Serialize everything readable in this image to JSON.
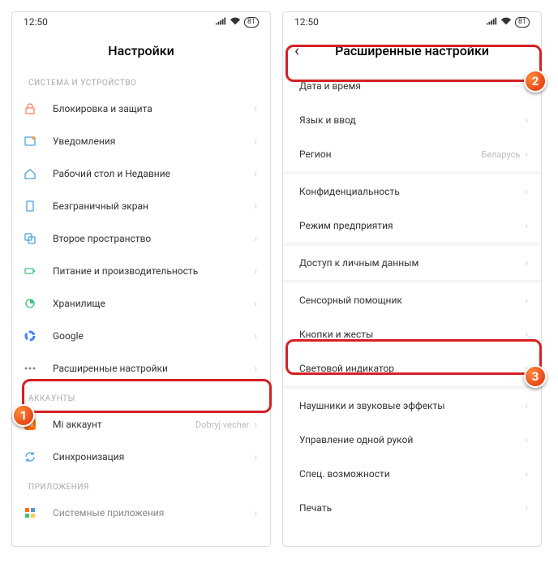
{
  "status": {
    "time": "12:50",
    "battery": "81"
  },
  "left": {
    "title": "Настройки",
    "section1": "СИСТЕМА И УСТРОЙСТВО",
    "items1": [
      "Блокировка и защита",
      "Уведомления",
      "Рабочий стол и Недавние",
      "Безграничный экран",
      "Второе пространство",
      "Питание и производительность",
      "Хранилище",
      "Google",
      "Расширенные настройки"
    ],
    "section2": "АККАУНТЫ",
    "items2": [
      {
        "label": "Mi аккаунт",
        "value": "Dobryj vecher"
      },
      {
        "label": "Синхронизация",
        "value": ""
      }
    ],
    "section3": "ПРИЛОЖЕНИЯ",
    "items3": [
      "Системные приложения"
    ]
  },
  "right": {
    "title": "Расширенные настройки",
    "groups": [
      [
        {
          "label": "Дата и время",
          "value": ""
        },
        {
          "label": "Язык и ввод",
          "value": ""
        },
        {
          "label": "Регион",
          "value": "Беларусь"
        }
      ],
      [
        {
          "label": "Конфиденциальность",
          "value": ""
        },
        {
          "label": "Режим предприятия",
          "value": ""
        }
      ],
      [
        {
          "label": "Доступ к личным данным",
          "value": ""
        }
      ],
      [
        {
          "label": "Сенсорный помощник",
          "value": ""
        },
        {
          "label": "Кнопки и жесты",
          "value": ""
        },
        {
          "label": "Световой индикатор",
          "value": ""
        }
      ],
      [
        {
          "label": "Наушники и звуковые эффекты",
          "value": ""
        },
        {
          "label": "Управление одной рукой",
          "value": ""
        },
        {
          "label": "Спец. возможности",
          "value": ""
        },
        {
          "label": "Печать",
          "value": ""
        }
      ]
    ]
  },
  "annotations": {
    "n1": "1",
    "n2": "2",
    "n3": "3"
  }
}
